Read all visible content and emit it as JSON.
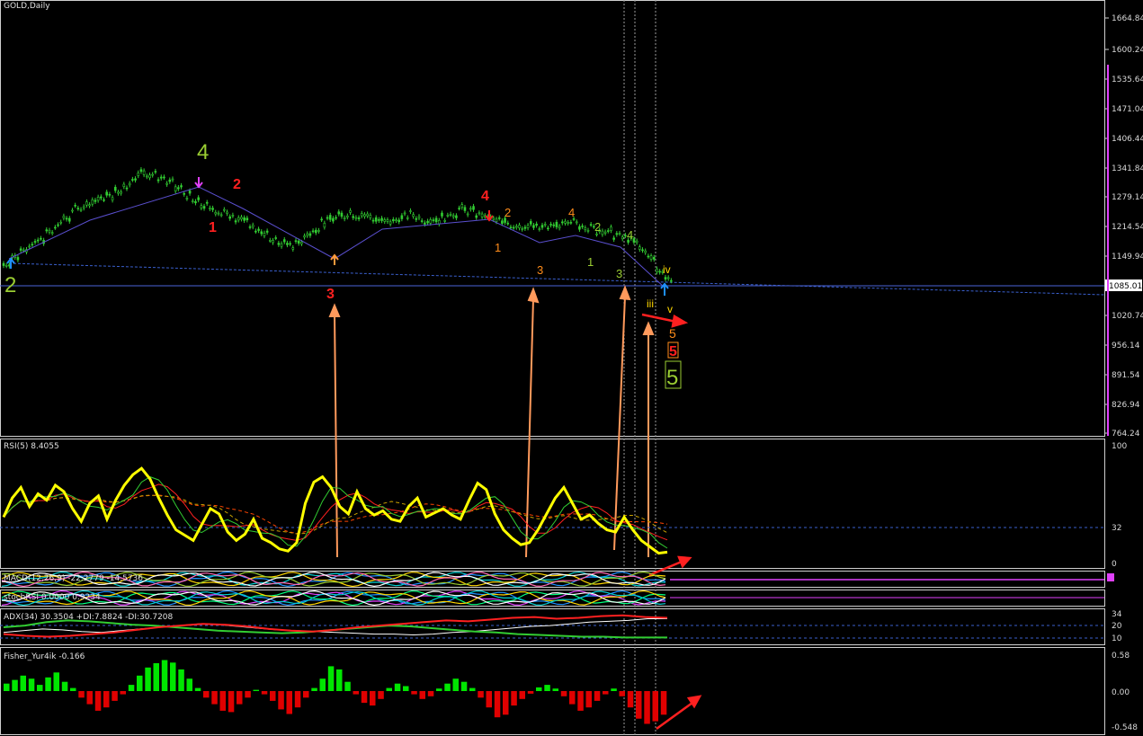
{
  "window": {
    "title": "GOLD,Daily"
  },
  "price_axis": {
    "labels": [
      "1664.84",
      "1600.24",
      "1535.64",
      "1471.04",
      "1406.44",
      "1341.84",
      "1279.14",
      "1214.54",
      "1149.94",
      "1085.01",
      "1020.74",
      "956.14",
      "891.54",
      "826.94",
      "764.24"
    ],
    "current_price": "1085.01"
  },
  "indicators": {
    "rsi": {
      "title": "RSI(5) 8.4055",
      "levels": [
        "100",
        "32",
        "0"
      ]
    },
    "macd": {
      "title": "MACD(12,26,9) -22.2779 -14.5736"
    },
    "stoch": {
      "title": "stochRSI 0.0000 0.9234"
    },
    "adx": {
      "title": "ADX(34) 30.3504 +DI:7.8824 -DI:30.7208",
      "levels": [
        "34",
        "20",
        "10"
      ]
    },
    "fisher": {
      "title": "Fisher_Yur4ik -0.166",
      "levels": [
        "0.58",
        "0.00",
        "-0.548"
      ]
    }
  },
  "wave_labels": [
    {
      "text": "4",
      "color": "#9acd32"
    },
    {
      "text": "2",
      "color": "#ff2020"
    },
    {
      "text": "1",
      "color": "#ff2020"
    },
    {
      "text": "2",
      "color": "#9acd32"
    },
    {
      "text": "3",
      "color": "#ff2020"
    },
    {
      "text": "4",
      "color": "#ff2020"
    },
    {
      "text": "2",
      "color": "#ff8c1a"
    },
    {
      "text": "1",
      "color": "#ff8c1a"
    },
    {
      "text": "3",
      "color": "#ff8c1a"
    },
    {
      "text": "4",
      "color": "#ff8c1a"
    },
    {
      "text": "2",
      "color": "#9acd32"
    },
    {
      "text": "1",
      "color": "#9acd32"
    },
    {
      "text": "4",
      "color": "#9acd32"
    },
    {
      "text": "3",
      "color": "#9acd32"
    },
    {
      "text": "iv",
      "color": "#ffd700"
    },
    {
      "text": "iii",
      "color": "#ffd700"
    },
    {
      "text": "v",
      "color": "#ffd700"
    },
    {
      "text": "5",
      "color": "#ff8c1a"
    },
    {
      "text": "5",
      "color": "#ff2020"
    },
    {
      "text": "5",
      "color": "#9acd32"
    }
  ],
  "chart_data": [
    {
      "type": "line",
      "title": "GOLD,Daily",
      "ylim": [
        764.24,
        1664.84
      ],
      "series": [
        {
          "values": [
            1120,
            1135,
            1150,
            1160,
            1170,
            1185,
            1200,
            1215,
            1230,
            1240,
            1248,
            1255,
            1262,
            1270,
            1285,
            1300,
            1310,
            1305,
            1295,
            1285,
            1275,
            1262,
            1250,
            1240,
            1232,
            1228,
            1222,
            1215,
            1205,
            1192,
            1180,
            1170,
            1162,
            1158,
            1165,
            1180,
            1195,
            1205,
            1215,
            1220,
            1225,
            1222,
            1218,
            1212,
            1208,
            1210,
            1214,
            1220,
            1215,
            1210,
            1212,
            1218,
            1225,
            1232,
            1228,
            1222,
            1215,
            1208,
            1205,
            1202,
            1200,
            1198,
            1196,
            1194,
            1198,
            1202,
            1205,
            1200,
            1195,
            1190,
            1186,
            1180,
            1172,
            1165,
            1150,
            1130,
            1105,
            1090
          ]
        }
      ]
    },
    {
      "type": "line",
      "title": "RSI(5) 8.4055",
      "ylim": [
        0,
        100
      ],
      "series": [
        {
          "values": [
            42,
            60,
            70,
            52,
            64,
            58,
            72,
            66,
            50,
            38,
            55,
            62,
            40,
            58,
            72,
            82,
            88,
            78,
            60,
            44,
            30,
            25,
            20,
            35,
            50,
            45,
            28,
            20,
            26,
            40,
            22,
            18,
            12,
            10,
            18,
            55,
            75,
            80,
            70,
            52,
            45,
            66,
            50,
            44,
            48,
            40,
            38,
            52,
            60,
            42,
            46,
            50,
            44,
            40,
            58,
            74,
            68,
            45,
            30,
            22,
            16,
            18,
            30,
            45,
            60,
            70,
            55,
            40,
            44,
            36,
            30,
            28,
            42,
            30,
            20,
            14,
            8,
            9
          ]
        }
      ]
    },
    {
      "type": "line",
      "title": "ADX(34) 30.3504 +DI:7.8824 -DI:30.7208",
      "ylim": [
        0,
        40
      ],
      "series": [
        {
          "values": [
            14,
            16,
            18,
            17,
            15,
            14,
            16,
            18,
            20,
            22,
            24,
            23,
            21,
            19,
            17,
            16,
            15,
            14,
            13,
            12,
            12,
            11,
            12,
            14,
            15,
            17,
            19,
            21,
            22,
            24,
            26,
            27,
            28,
            30,
            30
          ]
        },
        {
          "values": [
            20,
            22,
            26,
            28,
            27,
            25,
            23,
            22,
            20,
            18,
            16,
            15,
            14,
            13,
            14,
            16,
            18,
            20,
            22,
            21,
            19,
            17,
            15,
            14,
            12,
            11,
            10,
            9,
            9,
            8,
            8,
            8
          ]
        },
        {
          "values": [
            12,
            10,
            9,
            10,
            12,
            14,
            17,
            20,
            22,
            24,
            23,
            21,
            18,
            16,
            15,
            17,
            20,
            22,
            24,
            26,
            28,
            27,
            29,
            31,
            32,
            30,
            31,
            33,
            34,
            32,
            31
          ]
        }
      ]
    },
    {
      "type": "bar",
      "title": "Fisher_Yur4ik -0.166",
      "ylim": [
        -0.548,
        0.58
      ],
      "values": [
        0.12,
        0.18,
        0.25,
        0.2,
        0.1,
        0.22,
        0.3,
        0.15,
        0.05,
        -0.1,
        -0.2,
        -0.3,
        -0.25,
        -0.15,
        -0.05,
        0.1,
        0.25,
        0.38,
        0.45,
        0.5,
        0.46,
        0.35,
        0.2,
        0.05,
        -0.1,
        -0.2,
        -0.3,
        -0.32,
        -0.2,
        -0.1,
        0.02,
        -0.05,
        -0.15,
        -0.28,
        -0.35,
        -0.25,
        -0.1,
        0.05,
        0.2,
        0.4,
        0.35,
        0.15,
        -0.05,
        -0.18,
        -0.22,
        -0.12,
        0.05,
        0.12,
        0.08,
        -0.05,
        -0.12,
        -0.08,
        0.04,
        0.12,
        0.2,
        0.15,
        0.05,
        -0.1,
        -0.25,
        -0.4,
        -0.36,
        -0.22,
        -0.12,
        -0.04,
        0.06,
        0.1,
        0.04,
        -0.08,
        -0.2,
        -0.3,
        -0.25,
        -0.15,
        -0.05,
        0.04,
        -0.08,
        -0.25,
        -0.42,
        -0.5,
        -0.46,
        -0.36
      ]
    }
  ]
}
